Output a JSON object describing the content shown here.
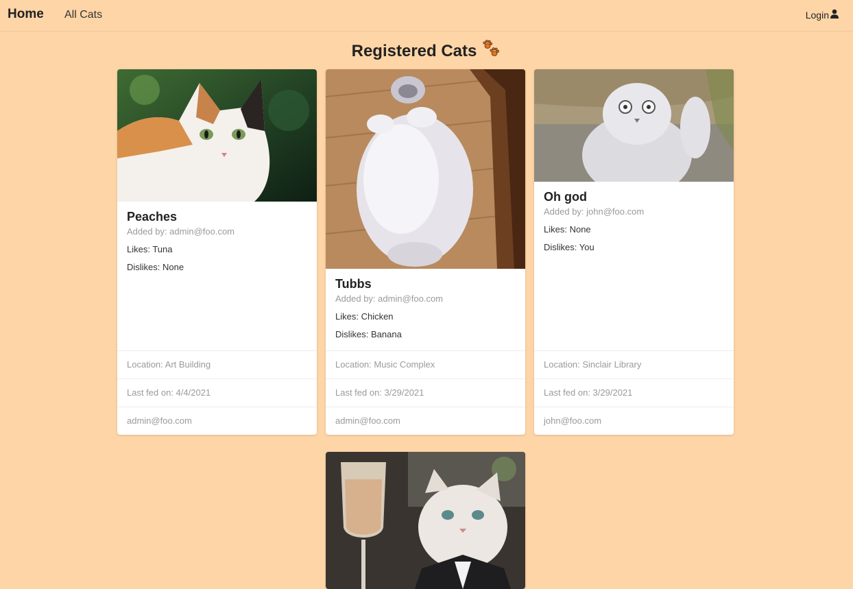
{
  "nav": {
    "home": "Home",
    "all_cats": "All Cats",
    "login": "Login"
  },
  "page_title": "Registered Cats",
  "title_icon": "paw-prints-icon",
  "cards": [
    {
      "name": "Peaches",
      "added_by": "Added by: admin@foo.com",
      "likes": "Likes: Tuna",
      "dislikes": "Dislikes: None",
      "location": "Location: Art Building",
      "last_fed": "Last fed on: 4/4/2021",
      "owner": "admin@foo.com"
    },
    {
      "name": "Tubbs",
      "added_by": "Added by: admin@foo.com",
      "likes": "Likes: Chicken",
      "dislikes": "Dislikes: Banana",
      "location": "Location: Music Complex",
      "last_fed": "Last fed on: 3/29/2021",
      "owner": "admin@foo.com"
    },
    {
      "name": "Oh god",
      "added_by": "Added by: john@foo.com",
      "likes": "Likes: None",
      "dislikes": "Dislikes: You",
      "location": "Location: Sinclair Library",
      "last_fed": "Last fed on: 3/29/2021",
      "owner": "john@foo.com"
    }
  ],
  "colors": {
    "background": "#fed5a7",
    "card": "#ffffff",
    "muted_text": "#9a9a9a"
  }
}
